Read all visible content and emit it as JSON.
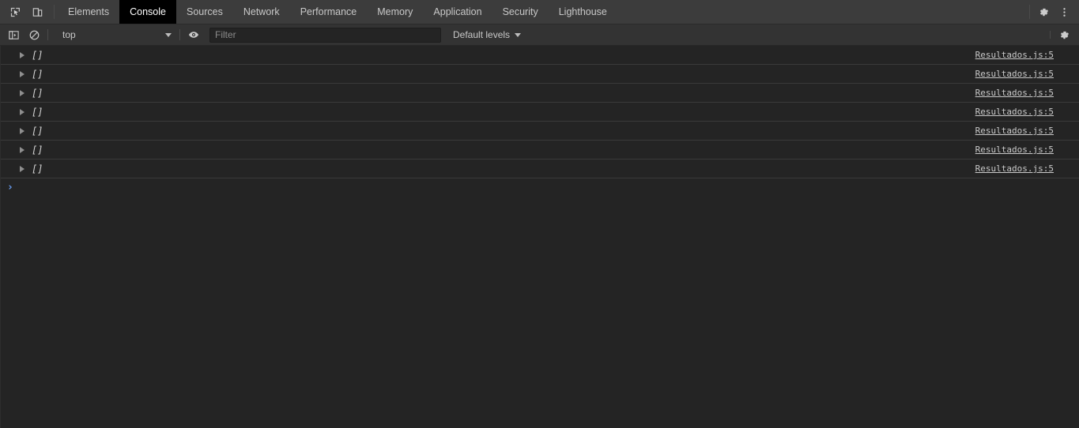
{
  "tabbar": {
    "icons": [
      {
        "name": "inspect-element-icon",
        "label": "Inspect element"
      },
      {
        "name": "device-toolbar-icon",
        "label": "Toggle device toolbar"
      }
    ],
    "tabs": [
      {
        "label": "Elements",
        "active": false
      },
      {
        "label": "Console",
        "active": true
      },
      {
        "label": "Sources",
        "active": false
      },
      {
        "label": "Network",
        "active": false
      },
      {
        "label": "Performance",
        "active": false
      },
      {
        "label": "Memory",
        "active": false
      },
      {
        "label": "Application",
        "active": false
      },
      {
        "label": "Security",
        "active": false
      },
      {
        "label": "Lighthouse",
        "active": false
      }
    ],
    "settings_label": "Settings",
    "more_label": "Customize and control DevTools"
  },
  "toolbar": {
    "sidebar_toggle_label": "Show console sidebar",
    "clear_label": "Clear console",
    "context_value": "top",
    "live_expression_label": "Create live expression",
    "filter_placeholder": "Filter",
    "filter_value": "",
    "levels_label": "Default levels",
    "settings_label": "Console settings"
  },
  "console": {
    "messages": [
      {
        "text": "[]",
        "source": "Resultados.js:5"
      },
      {
        "text": "[]",
        "source": "Resultados.js:5"
      },
      {
        "text": "[]",
        "source": "Resultados.js:5"
      },
      {
        "text": "[]",
        "source": "Resultados.js:5"
      },
      {
        "text": "[]",
        "source": "Resultados.js:5"
      },
      {
        "text": "[]",
        "source": "Resultados.js:5"
      },
      {
        "text": "[]",
        "source": "Resultados.js:5"
      }
    ],
    "prompt_chevron": "›",
    "prompt_value": ""
  },
  "colors": {
    "tabbar_bg": "#3c3c3c",
    "toolbar_bg": "#333333",
    "body_bg": "#242424",
    "active_tab_bg": "#000000",
    "row_separator": "#3a3a3a",
    "prompt_accent": "#6aa0f7",
    "text_primary": "#d4d4d4",
    "text_muted": "#8b8b8b"
  }
}
